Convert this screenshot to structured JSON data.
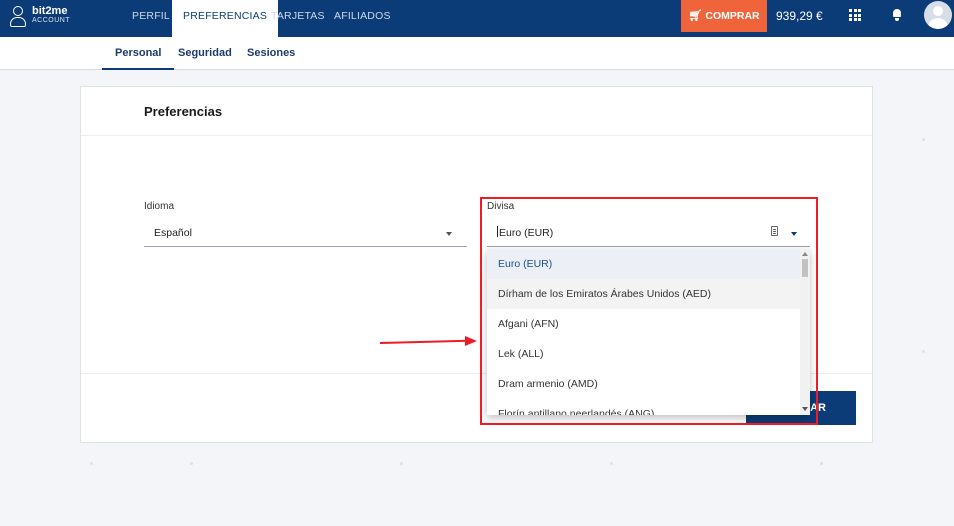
{
  "topbar": {
    "brand": "bit2me",
    "brand_sub": "ACCOUNT",
    "nav": [
      "PERFIL",
      "PREFERENCIAS",
      "TARJETAS",
      "AFILIADOS"
    ],
    "buy_label": "COMPRAR",
    "balance": "939,29 €"
  },
  "subnav": {
    "items": [
      "Personal",
      "Seguridad",
      "Sesiones"
    ]
  },
  "card": {
    "title": "Preferencias",
    "language_label": "Idioma",
    "language_value": "Español",
    "currency_label": "Divisa",
    "currency_value": "Euro (EUR)",
    "save_label_visible": "AR"
  },
  "currency_options": [
    "Euro (EUR)",
    "Dírham de los Emiratos Árabes Unidos (AED)",
    "Afgani (AFN)",
    "Lek (ALL)",
    "Dram armenio (AMD)",
    "Florín antillano neerlandés (ANG)"
  ],
  "colors": {
    "nav_bg": "#0c3c78",
    "buy_button": "#f0643c",
    "annotation": "#ee1c24"
  }
}
